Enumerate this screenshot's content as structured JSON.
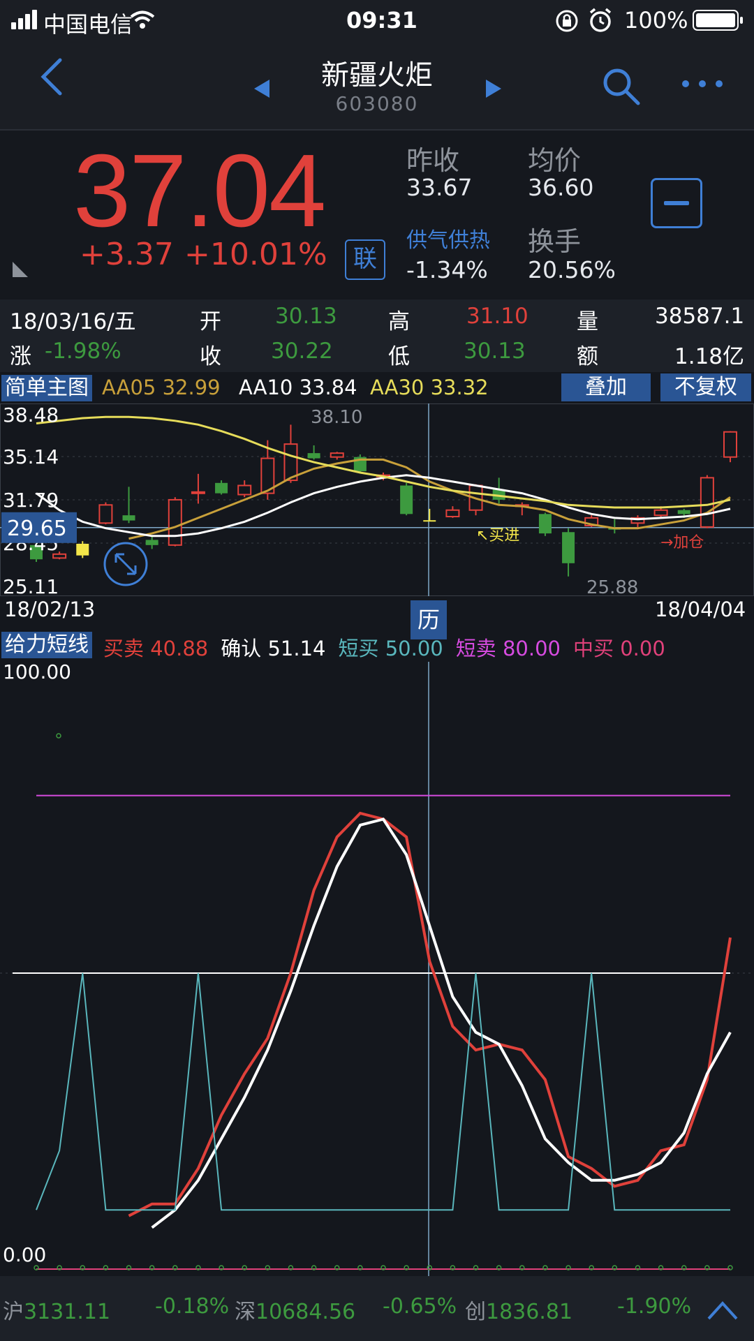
{
  "status": {
    "carrier": "中国电信",
    "time": "09:31",
    "battery": "100%"
  },
  "nav": {
    "title": "新疆火炬",
    "code": "603080",
    "icons": [
      "back-icon",
      "prev-stock-icon",
      "next-stock-icon",
      "search-icon",
      "more-icon"
    ]
  },
  "quote": {
    "price": "37.04",
    "change": "+3.37",
    "change_pct": "+10.01%",
    "link_label": "联",
    "prev_close_label": "昨收",
    "prev_close": "33.67",
    "avg_label": "均价",
    "avg": "36.60",
    "sector_label": "供气供热",
    "sector_change": "-1.34%",
    "turnover_label": "换手",
    "turnover": "20.56%"
  },
  "day": {
    "date": "18/03/16/五",
    "open_label": "开",
    "open": "30.13",
    "high_label": "高",
    "high": "31.10",
    "vol_label": "量",
    "vol": "38587.1",
    "chg_label": "涨",
    "chg": "-1.98%",
    "close_label": "收",
    "close": "30.22",
    "low_label": "低",
    "low": "30.13",
    "amt_label": "额",
    "amt": "1.18亿"
  },
  "main_chart": {
    "name": "简单主图",
    "aa05": "AA05 32.99",
    "aa10": "AA10 33.84",
    "aa30": "AA30 33.32",
    "overlay_button": "叠加",
    "adjust_button": "不复权",
    "cursor_price": "29.65",
    "history_button": "历",
    "start_date": "18/02/13",
    "end_date": "18/04/04",
    "buy_label": "↖买进",
    "add_label": "→加仓",
    "colors": {
      "up": "#e0413b",
      "down": "#3d9a3f",
      "aa05": "#c8a03a",
      "aa10": "#ffffff",
      "aa30": "#e6dc5a",
      "highlight": "#f3e64a"
    }
  },
  "chart_data": [
    {
      "type": "candlestick",
      "ylim": [
        25.11,
        38.48
      ],
      "y_ticks": [
        "38.48",
        "35.14",
        "31.79",
        "28.45",
        "25.11"
      ],
      "high_label": "38.10",
      "low_label": "25.88",
      "candles": [
        {
          "o": 28.3,
          "c": 27.2,
          "h": 28.6,
          "l": 27.0
        },
        {
          "o": 27.3,
          "c": 27.6,
          "h": 27.8,
          "l": 27.2
        },
        {
          "o": 27.5,
          "c": 28.4,
          "h": 28.6,
          "l": 27.3
        },
        {
          "o": 30.0,
          "c": 31.4,
          "h": 31.6,
          "l": 29.9
        },
        {
          "o": 30.6,
          "c": 30.2,
          "h": 32.8,
          "l": 30.0
        },
        {
          "o": 28.7,
          "c": 28.3,
          "h": 29.0,
          "l": 28.0
        },
        {
          "o": 28.3,
          "c": 31.8,
          "h": 32.0,
          "l": 28.2
        },
        {
          "o": 32.3,
          "c": 32.4,
          "h": 33.8,
          "l": 31.5
        },
        {
          "o": 33.1,
          "c": 32.3,
          "h": 33.3,
          "l": 32.2
        },
        {
          "o": 32.2,
          "c": 32.9,
          "h": 33.3,
          "l": 32.0
        },
        {
          "o": 32.3,
          "c": 35.0,
          "h": 36.4,
          "l": 31.8
        },
        {
          "o": 33.3,
          "c": 36.1,
          "h": 37.6,
          "l": 33.1
        },
        {
          "o": 35.4,
          "c": 35.0,
          "h": 36.0,
          "l": 34.9
        },
        {
          "o": 35.1,
          "c": 35.4,
          "h": 35.5,
          "l": 34.9
        },
        {
          "o": 35.1,
          "c": 34.0,
          "h": 35.3,
          "l": 33.9
        },
        {
          "o": 33.6,
          "c": 33.7,
          "h": 33.9,
          "l": 33.3
        },
        {
          "o": 32.9,
          "c": 30.7,
          "h": 33.1,
          "l": 30.6
        },
        {
          "o": 30.13,
          "c": 30.22,
          "h": 31.1,
          "l": 30.13
        },
        {
          "o": 30.5,
          "c": 31.0,
          "h": 31.3,
          "l": 30.4
        },
        {
          "o": 31.0,
          "c": 32.9,
          "h": 33.0,
          "l": 30.6
        },
        {
          "o": 32.6,
          "c": 31.8,
          "h": 33.5,
          "l": 31.5
        },
        {
          "o": 31.3,
          "c": 31.4,
          "h": 31.6,
          "l": 30.6
        },
        {
          "o": 30.7,
          "c": 29.2,
          "h": 30.8,
          "l": 29.0
        },
        {
          "o": 29.3,
          "c": 26.9,
          "h": 29.6,
          "l": 25.88
        },
        {
          "o": 29.8,
          "c": 30.4,
          "h": 30.6,
          "l": 29.7
        },
        {
          "o": 29.6,
          "c": 29.5,
          "h": 30.3,
          "l": 29.2
        },
        {
          "o": 30.0,
          "c": 30.4,
          "h": 30.6,
          "l": 29.6
        },
        {
          "o": 30.6,
          "c": 31.0,
          "h": 31.3,
          "l": 30.4
        },
        {
          "o": 31.0,
          "c": 30.7,
          "h": 31.1,
          "l": 30.4
        },
        {
          "o": 29.7,
          "c": 33.5,
          "h": 33.7,
          "l": 29.6
        },
        {
          "o": 35.1,
          "c": 37.04,
          "h": 37.1,
          "l": 34.7
        }
      ],
      "ma_lines": {
        "AA05": [
          null,
          null,
          null,
          null,
          28.8,
          29.2,
          29.7,
          30.4,
          31.1,
          31.8,
          32.5,
          33.5,
          34.2,
          34.6,
          34.9,
          34.9,
          34.3,
          33.2,
          32.5,
          31.9,
          31.4,
          31.3,
          31.0,
          30.3,
          29.9,
          29.6,
          29.6,
          29.9,
          30.2,
          30.8,
          32.0
        ],
        "AA10": [
          32.3,
          31.0,
          30.1,
          29.6,
          29.3,
          29.0,
          29.0,
          29.2,
          29.6,
          30.1,
          30.8,
          31.6,
          32.3,
          32.8,
          33.2,
          33.5,
          33.7,
          33.5,
          33.2,
          32.9,
          32.6,
          32.3,
          31.8,
          31.2,
          30.7,
          30.4,
          30.3,
          30.4,
          30.5,
          30.7,
          31.1
        ],
        "AA30": [
          37.7,
          37.9,
          38.1,
          38.2,
          38.2,
          38.1,
          37.9,
          37.6,
          37.1,
          36.5,
          35.8,
          35.2,
          34.7,
          34.3,
          33.9,
          33.6,
          33.2,
          32.8,
          32.5,
          32.3,
          32.1,
          31.9,
          31.7,
          31.4,
          31.3,
          31.2,
          31.2,
          31.2,
          31.3,
          31.4,
          31.8
        ]
      }
    },
    {
      "type": "line",
      "title": "给力短线",
      "ylim": [
        0,
        100
      ],
      "y_ticks": [
        "100.00",
        "0.00"
      ],
      "legend": [
        {
          "label": "买卖 40.88",
          "color": "#e0413b"
        },
        {
          "label": "确认 51.14",
          "color": "#ffffff"
        },
        {
          "label": "短买 50.00",
          "color": "#5ab7bd"
        },
        {
          "label": "短卖 80.00",
          "color": "#d64be0"
        },
        {
          "label": "中买 0.00",
          "color": "#e0417a"
        }
      ],
      "series": [
        {
          "name": "买卖",
          "color": "#e0413b",
          "values": [
            null,
            null,
            null,
            null,
            9,
            11,
            11,
            17,
            26,
            33,
            39,
            50,
            64,
            73,
            77,
            76,
            73,
            52,
            41,
            37,
            38,
            37,
            32,
            19,
            17,
            14,
            15,
            20,
            21,
            32,
            56
          ]
        },
        {
          "name": "确认",
          "color": "#ffffff",
          "values": [
            null,
            null,
            null,
            null,
            null,
            7,
            10,
            15,
            22,
            29,
            37,
            47,
            58,
            68,
            75,
            76,
            70,
            58,
            46,
            40,
            38,
            31,
            22,
            18,
            15,
            15,
            16,
            18,
            23,
            33,
            40
          ]
        },
        {
          "name": "短买",
          "color": "#5ab7bd",
          "values": [
            10,
            20,
            50,
            10,
            10,
            10,
            10,
            50,
            10,
            10,
            10,
            10,
            10,
            10,
            10,
            10,
            10,
            10,
            10,
            50,
            10,
            10,
            10,
            10,
            50,
            10,
            10,
            10,
            10,
            10,
            10
          ]
        },
        {
          "name": "短卖",
          "color": "#d64be0",
          "values": [
            80,
            80,
            80,
            80,
            80,
            80,
            80,
            80,
            80,
            80,
            80,
            80,
            80,
            80,
            80,
            80,
            80,
            80,
            80,
            80,
            80,
            80,
            80,
            80,
            80,
            80,
            80,
            80,
            80,
            80,
            80
          ]
        },
        {
          "name": "中买",
          "color": "#e0417a",
          "values": [
            0,
            0,
            0,
            0,
            0,
            0,
            0,
            0,
            0,
            0,
            0,
            0,
            0,
            0,
            0,
            0,
            0,
            0,
            0,
            0,
            0,
            0,
            0,
            0,
            0,
            0,
            0,
            0,
            0,
            0,
            0
          ]
        }
      ]
    }
  ],
  "sub_chart": {
    "name": "给力短线",
    "y_top": "100.00",
    "y_bottom": "0.00"
  },
  "bottom": {
    "sh": "沪3131.11",
    "sh_chg": "-0.18%",
    "sz": "深10684.56",
    "sz_chg": "-0.65%",
    "cy": "创1836.81",
    "cy_chg": "-1.90%"
  }
}
